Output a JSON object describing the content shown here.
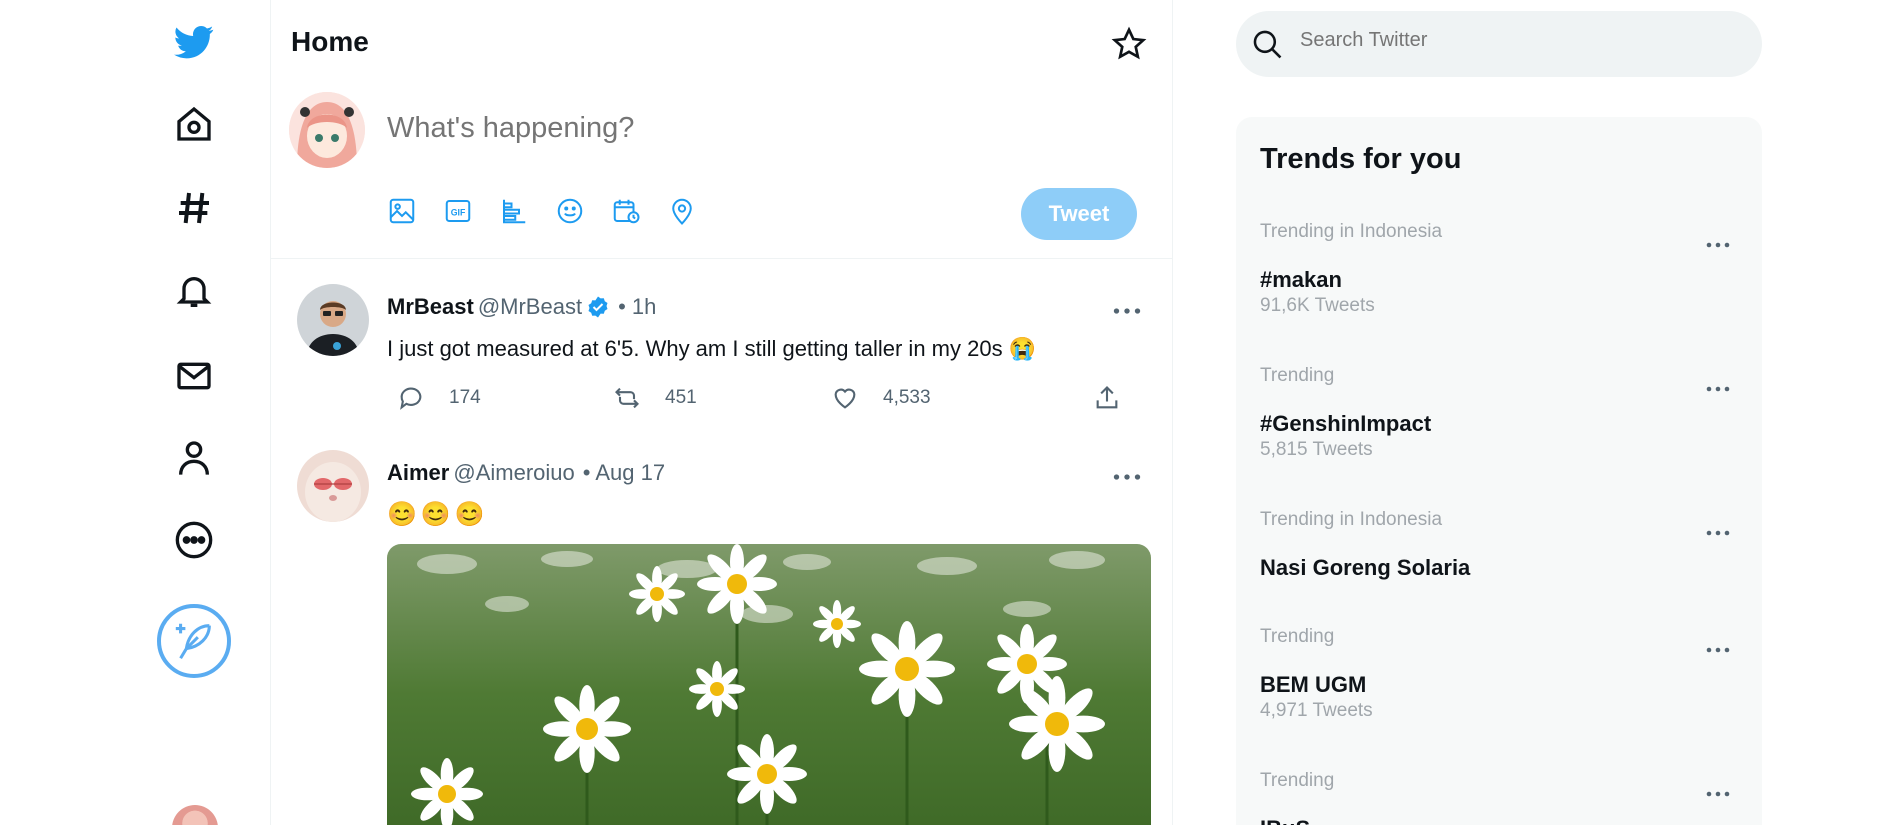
{
  "header": {
    "title": "Home"
  },
  "compose": {
    "placeholder": "What's happening?",
    "tweet_label": "Tweet"
  },
  "nav": {
    "items": [
      "twitter-logo",
      "home",
      "explore",
      "notifications",
      "messages",
      "profile",
      "more"
    ],
    "compose_icon": "feather-plus"
  },
  "tweets": [
    {
      "name": "MrBeast",
      "handle": "@MrBeast",
      "verified": true,
      "time": "• 1h",
      "text": "I just got measured at 6'5. Why am I still getting taller in my 20s 😭",
      "replies": "174",
      "retweets": "451",
      "likes": "4,533"
    },
    {
      "name": "Aimer",
      "handle": "@Aimeroiuo",
      "time": "• Aug 17",
      "text": "😊😊😊",
      "media": "daisy flowers photo"
    }
  ],
  "search": {
    "placeholder": "Search Twitter"
  },
  "trends": {
    "title": "Trends for you",
    "items": [
      {
        "category": "Trending in Indonesia",
        "name": "#makan",
        "count": "91,6K Tweets"
      },
      {
        "category": "Trending",
        "name": "#GenshinImpact",
        "count": "5,815 Tweets"
      },
      {
        "category": "Trending in Indonesia",
        "name": "Nasi Goreng Solaria",
        "count": ""
      },
      {
        "category": "Trending",
        "name": "BEM UGM",
        "count": "4,971 Tweets"
      },
      {
        "category": "Trending",
        "name": "IBuS",
        "count": ""
      }
    ]
  },
  "colors": {
    "accent": "#1d9bf0",
    "tweet_button": "#8ecdf8",
    "secondary_text": "#536471"
  }
}
